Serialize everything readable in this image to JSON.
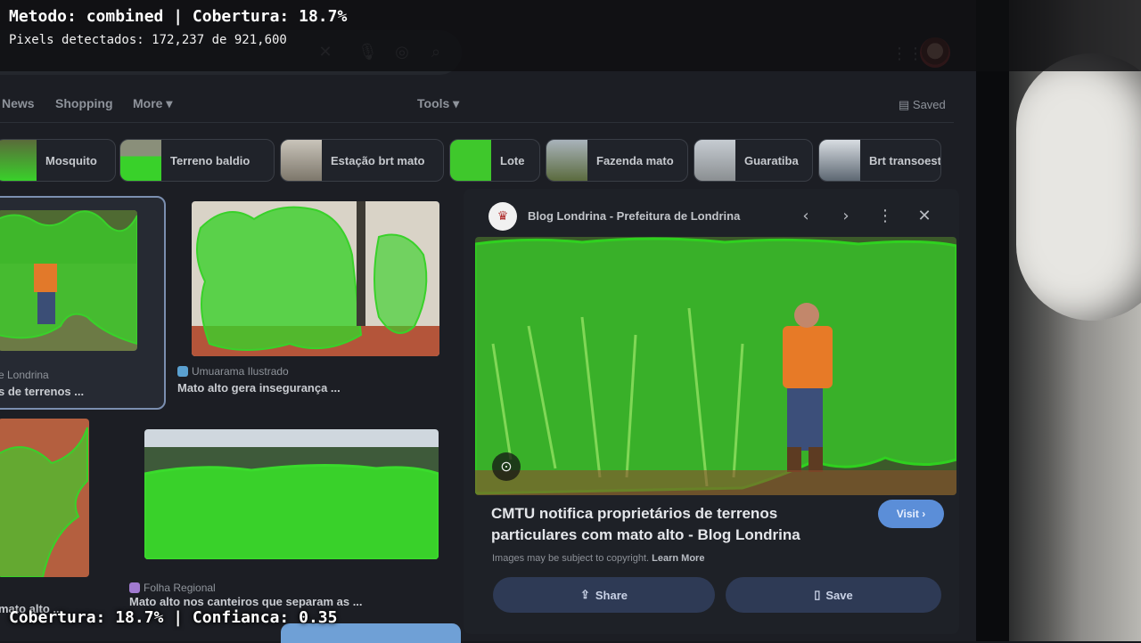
{
  "overlay": {
    "title": "Metodo: combined | Cobertura: 18.7%",
    "pixels": "Pixels detectados: 172,237 de 921,600",
    "footer": "Cobertura: 18.7% | Confianca: 0.35",
    "mask_color": "#39d12a"
  },
  "nav": {
    "items": [
      "News",
      "Shopping",
      "More ▾"
    ],
    "tools": "Tools ▾",
    "saved": "Saved"
  },
  "chips": [
    "Mosquito",
    "Terreno baldio",
    "Estação brt mato",
    "Lote",
    "Fazenda mato",
    "Guaratiba",
    "Brt transoeste"
  ],
  "results": [
    {
      "source": "e Londrina",
      "title": "s de terrenos ..."
    },
    {
      "source": "Umuarama Ilustrado",
      "title": "Mato alto gera insegurança ..."
    },
    {
      "source": "",
      "title": "mato alto ..."
    },
    {
      "source": "Folha Regional",
      "title": "Mato alto nos canteiros que separam as ..."
    }
  ],
  "panel": {
    "source": "Blog Londrina - Prefeitura de Londrina",
    "headline": "CMTU notifica proprietários de terrenos particulares com mato alto - Blog Londrina",
    "visit": "Visit ›",
    "copyright": "Images may be subject to copyright.",
    "learn_more": "Learn More",
    "share": "Share",
    "save": "Save"
  },
  "colors": {
    "page_bg": "#1c1e24",
    "accent": "#5b8ed8",
    "button_bg": "#2e3a55",
    "mask": "#39d12a"
  },
  "icons": [
    "close-icon",
    "mic-icon",
    "camera-icon",
    "search-icon",
    "apps-icon",
    "avatar",
    "saved-icon",
    "chevron-left-icon",
    "chevron-right-icon",
    "more-vert-icon",
    "lens-icon",
    "share-icon",
    "bookmark-icon"
  ]
}
